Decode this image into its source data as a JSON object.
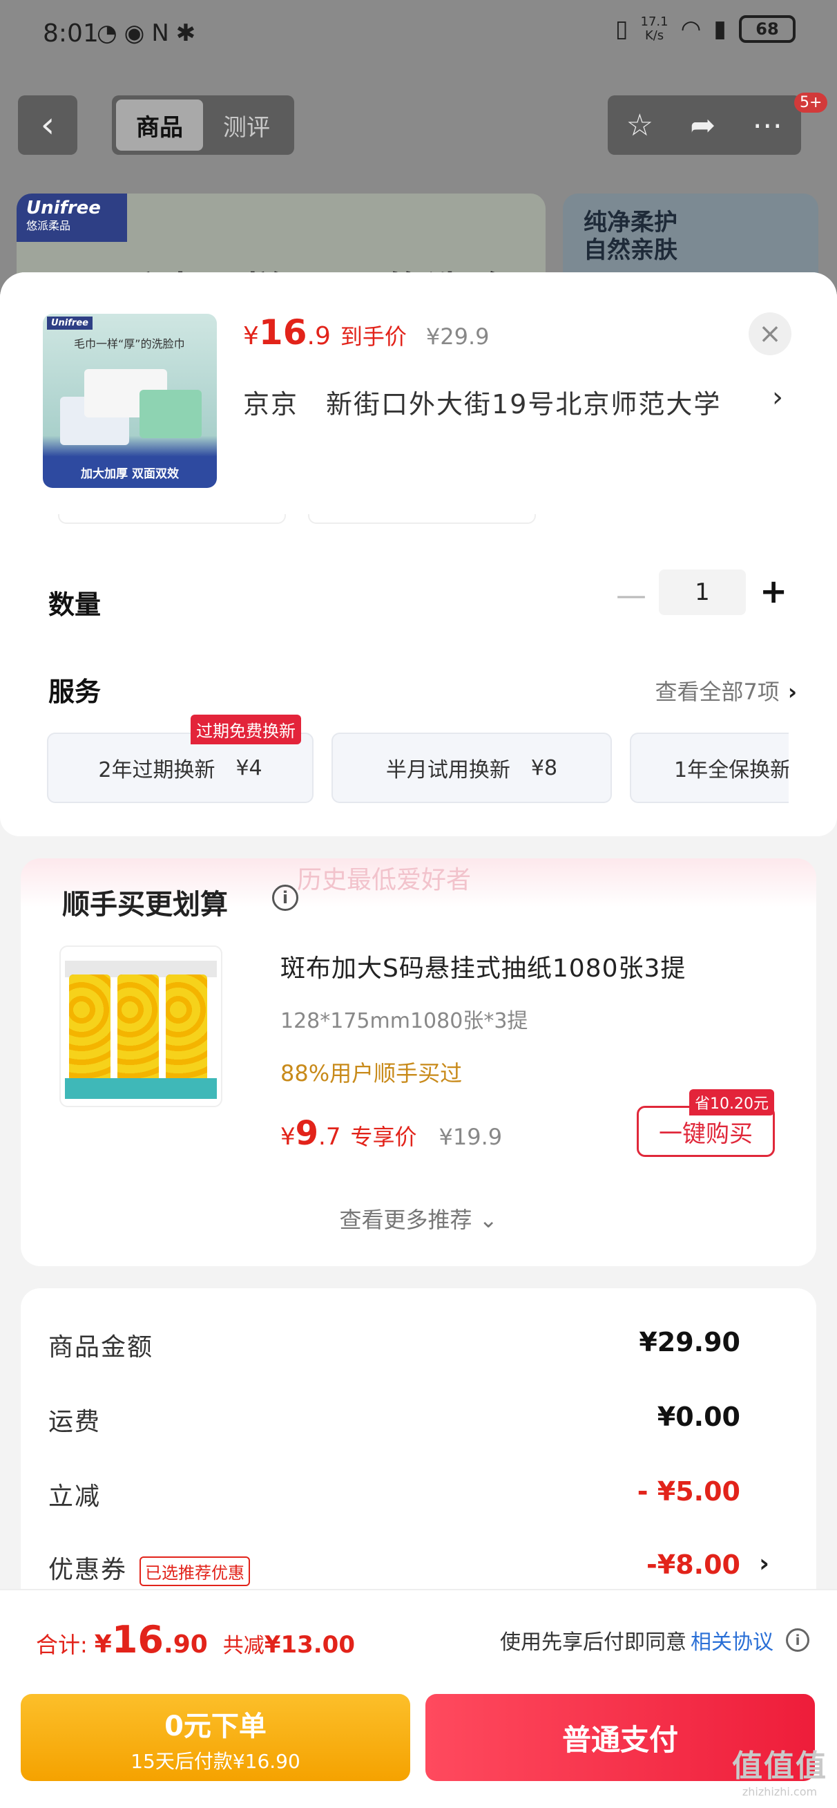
{
  "status_bar": {
    "time": "8:01",
    "left_icons": "◔◉N✱",
    "speed": "17.1\nK/s",
    "battery": "68"
  },
  "top_nav": {
    "tabs": [
      {
        "label": "商品",
        "active": true
      },
      {
        "label": "测评",
        "active": false
      }
    ],
    "badge": "5+"
  },
  "banners": {
    "left_logo": "Unifree",
    "left_logo_sub": "悠派柔品",
    "left_headline": "毛巾一样“厚”的洗脸巾",
    "right_text_1": "纯净柔护",
    "right_text_2": "自然亲肤"
  },
  "product": {
    "image_logo": "Unifree",
    "image_title": "毛巾一样“厚”的洗脸巾",
    "image_footer": "加大加厚  双面双效",
    "price_currency": "¥",
    "price_int": "16",
    "price_dec": ".9",
    "price_label": "到手价",
    "price_old": "¥29.9",
    "city": "京京",
    "address": "新街口外大街19号北京师范大学"
  },
  "quantity": {
    "title": "数量",
    "value": "1"
  },
  "services": {
    "title": "服务",
    "view_all": "查看全部7项",
    "tag": "过期免费换新",
    "items": [
      {
        "name": "2年过期换新",
        "price": "¥4"
      },
      {
        "name": "半月试用换新",
        "price": "¥8"
      },
      {
        "name": "1年全保换新",
        "price": ""
      }
    ]
  },
  "recommend": {
    "watermark": "历史最低爱好者",
    "title": "顺手买更划算",
    "name": "斑布加大S码悬挂式抽纸1080张3提",
    "spec": "128*175mm1080张*3提",
    "bought": "88%用户顺手买过",
    "price_currency": "¥",
    "price_int": "9",
    "price_dec": ".7",
    "price_label": "专享价",
    "price_old": "¥19.9",
    "save_badge": "省10.20元",
    "buy_button": "一键购买",
    "more": "查看更多推荐"
  },
  "summary": {
    "rows": [
      {
        "label": "商品金额",
        "value": "¥29.90"
      },
      {
        "label": "运费",
        "value": "¥0.00"
      },
      {
        "label": "立减",
        "value": "- ¥5.00"
      },
      {
        "label": "优惠券",
        "value": "-¥8.00",
        "tag": "已选推荐优惠"
      }
    ]
  },
  "footer": {
    "total_label": "合计:",
    "total_currency": "¥",
    "total_int": "16",
    "total_dec": ".90",
    "saved_label": "共减",
    "saved_value": "¥13.00",
    "agree_text": "使用先享后付即同意",
    "agree_link": "相关协议",
    "pay_later_title": "0元下单",
    "pay_later_sub": "15天后付款¥16.90",
    "pay_normal": "普通支付",
    "watermark_1": "值值值",
    "watermark_2": "zhizhizhi.com"
  },
  "colors": {
    "accent_red": "#e2231a",
    "pay_later_yellow": "#f5a200",
    "pay_normal_red": "#ee1d3a",
    "link_blue": "#2a6fd6"
  }
}
